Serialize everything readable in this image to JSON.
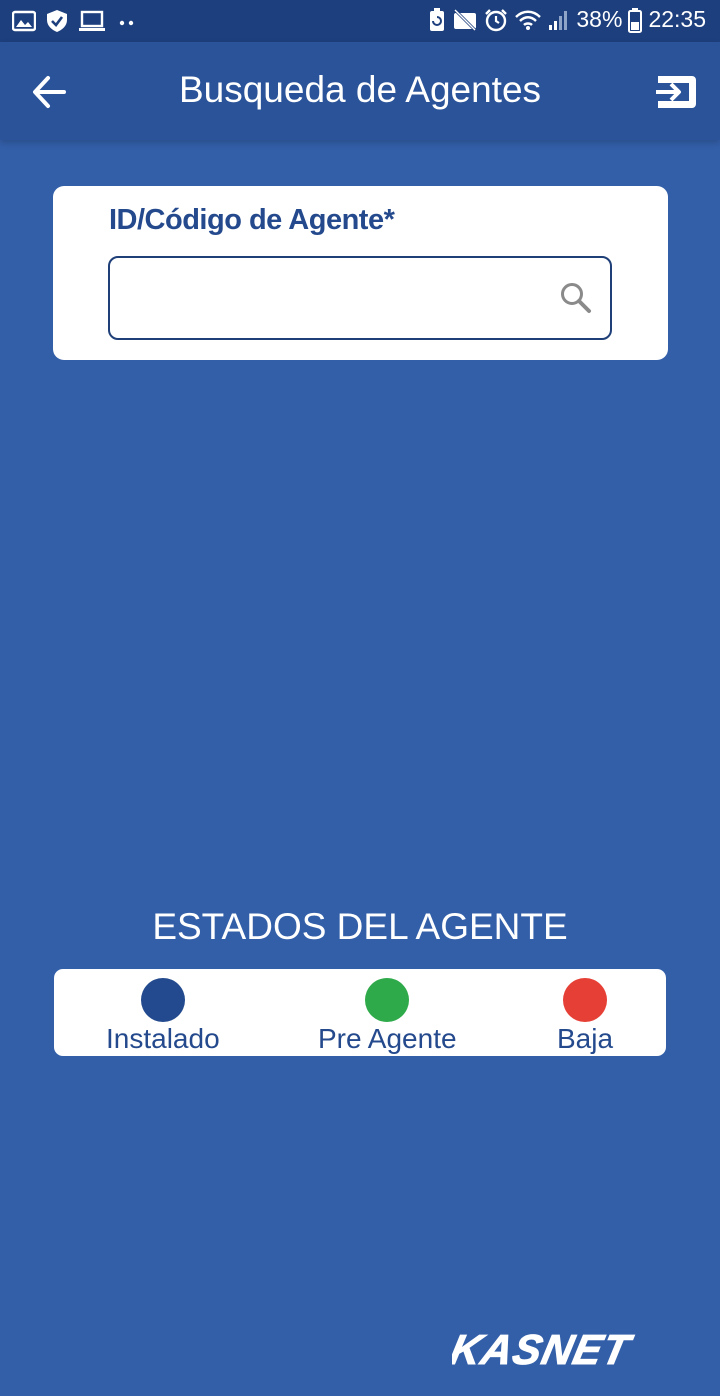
{
  "status_bar": {
    "battery_percent": "38%",
    "time": "22:35",
    "notification_icons": [
      "image-icon",
      "shield-icon",
      "laptop-icon",
      "more-dots-icon"
    ],
    "system_icons": [
      "battery-saver-icon",
      "no-camera-icon",
      "alarm-icon",
      "wifi-icon",
      "signal-icon",
      "battery-icon"
    ]
  },
  "app_bar": {
    "title": "Busqueda de Agentes",
    "back_icon": "arrow-back-icon",
    "logout_icon": "logout-icon"
  },
  "search": {
    "label": "ID/Código de Agente*",
    "value": "",
    "placeholder": "",
    "icon": "search-icon"
  },
  "states": {
    "title": "ESTADOS DEL AGENTE",
    "items": [
      {
        "label": "Instalado",
        "color": "#234a8e"
      },
      {
        "label": "Pre Agente",
        "color": "#2eaa4a"
      },
      {
        "label": "Baja",
        "color": "#e63f35"
      }
    ]
  },
  "brand": {
    "logo_text": "KASNET"
  },
  "colors": {
    "background": "#335fa9",
    "app_bar": "#2a5399",
    "status_bar": "#1d3f7d",
    "accent_text": "#244a8d"
  }
}
